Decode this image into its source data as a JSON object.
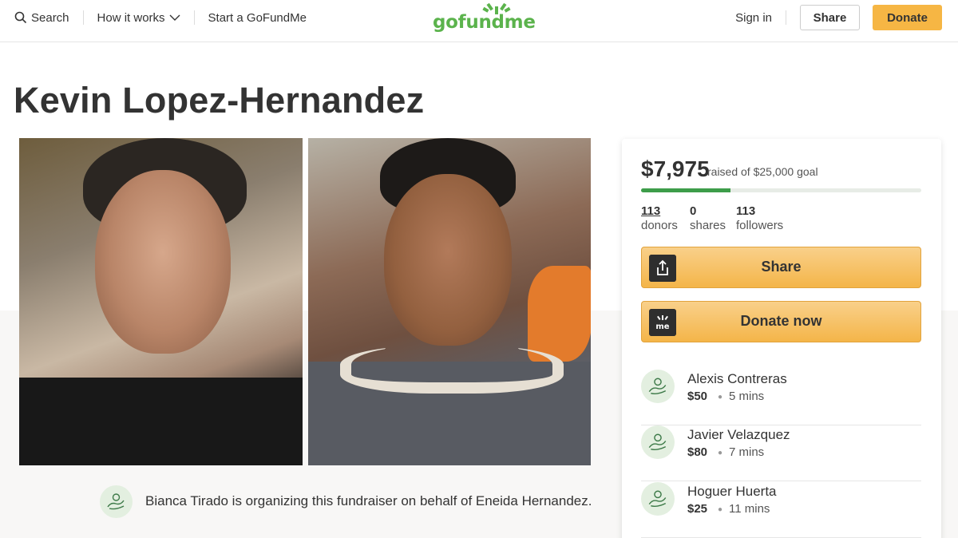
{
  "header": {
    "search_label": "Search",
    "how_it_works_label": "How it works",
    "start_label": "Start a GoFundMe",
    "logo_text": "gofundme",
    "signin_label": "Sign in",
    "share_label": "Share",
    "donate_label": "Donate"
  },
  "campaign": {
    "title": "Kevin Lopez-Hernandez",
    "organizer_text": "Bianca Tirado is organizing this fundraiser on behalf of Eneida Hernandez."
  },
  "panel": {
    "raised_amount": "$7,975",
    "raised_text": "raised of $25,000 goal",
    "progress_fraction": 0.319,
    "stats": [
      {
        "num": "113",
        "label": "donors"
      },
      {
        "num": "0",
        "label": "shares"
      },
      {
        "num": "113",
        "label": "followers"
      }
    ],
    "share_label": "Share",
    "donate_now_label": "Donate now",
    "donations": [
      {
        "name": "Alexis Contreras",
        "amount": "$50",
        "time": "5 mins"
      },
      {
        "name": "Javier Velazquez",
        "amount": "$80",
        "time": "7 mins"
      },
      {
        "name": "Hoguer Huerta",
        "amount": "$25",
        "time": "11 mins"
      }
    ]
  },
  "icons": {
    "search": "search-icon",
    "chevron": "chevron-down-icon",
    "share": "share-upload-icon",
    "donate": "gofundme-me-icon",
    "avatar": "hands-avatar-icon"
  },
  "colors": {
    "brand_green": "#5bb34c",
    "donate_orange": "#f6b644",
    "progress_green": "#3d9d4a"
  }
}
